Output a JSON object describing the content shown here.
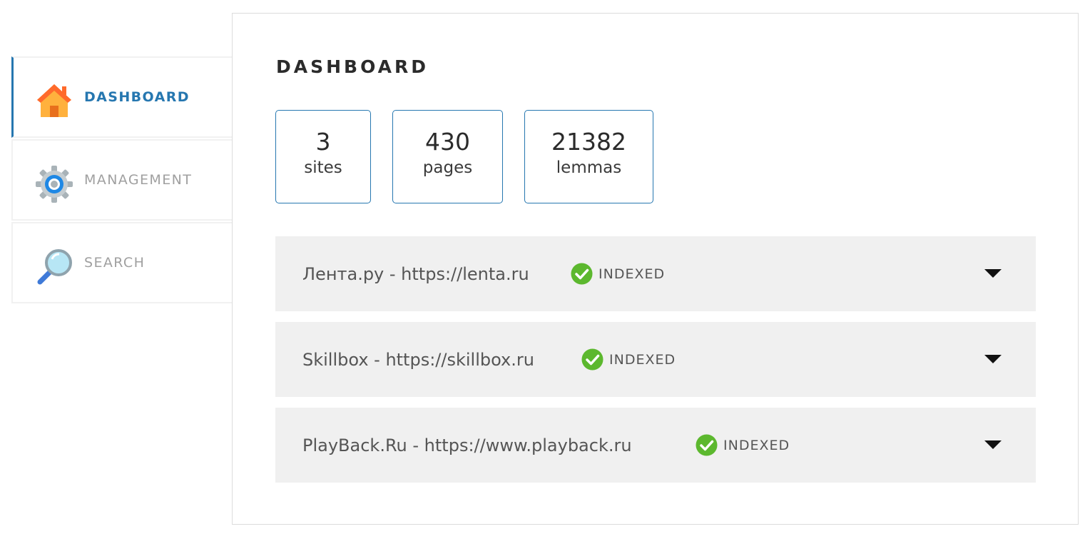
{
  "nav": {
    "items": [
      {
        "label": "DASHBOARD",
        "icon": "house-icon",
        "active": true
      },
      {
        "label": "MANAGEMENT",
        "icon": "gear-icon",
        "active": false
      },
      {
        "label": "SEARCH",
        "icon": "magnifier-icon",
        "active": false
      }
    ]
  },
  "main": {
    "title": "DASHBOARD",
    "stats": [
      {
        "value": "3",
        "label": "sites"
      },
      {
        "value": "430",
        "label": "pages"
      },
      {
        "value": "21382",
        "label": "lemmas"
      }
    ],
    "sites": [
      {
        "title": "Лента.ру - https://lenta.ru",
        "status": "INDEXED"
      },
      {
        "title": "Skillbox - https://skillbox.ru",
        "status": "INDEXED"
      },
      {
        "title": "PlayBack.Ru - https://www.playback.ru",
        "status": "INDEXED"
      }
    ]
  },
  "colors": {
    "accent": "#2677b0",
    "row_bg": "#f0f0f0",
    "status_ok": "#5cb82e"
  }
}
